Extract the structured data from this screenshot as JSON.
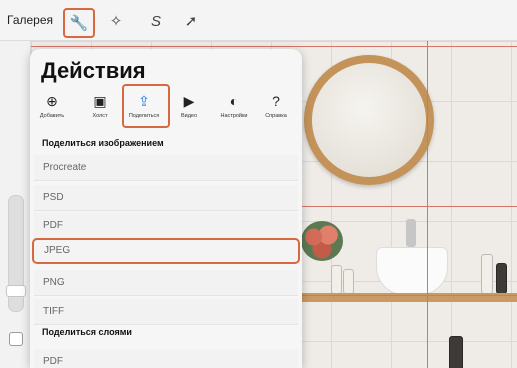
{
  "topbar": {
    "gallery_label": "Галерея",
    "tools": [
      {
        "icon": "wrench-icon",
        "glyph": "🔧"
      },
      {
        "icon": "magic-wand-icon",
        "glyph": "✧"
      },
      {
        "icon": "selection-icon",
        "glyph": "S"
      },
      {
        "icon": "arrow-icon",
        "glyph": "➚"
      }
    ]
  },
  "actions_panel": {
    "title": "Действия",
    "tabs": [
      {
        "label": "Добавить",
        "icon": "add-icon",
        "glyph": "⊕"
      },
      {
        "label": "Холст",
        "icon": "canvas-icon",
        "glyph": "▣"
      },
      {
        "label": "Поделиться",
        "icon": "share-icon",
        "glyph": "⇪"
      },
      {
        "label": "Видео",
        "icon": "play-icon",
        "glyph": "▶"
      },
      {
        "label": "Настройки",
        "icon": "toggle-icon",
        "glyph": "◐"
      },
      {
        "label": "Справка",
        "icon": "help-icon",
        "glyph": "?"
      }
    ],
    "share_image_heading": "Поделиться изображением",
    "image_formats": [
      "Procreate",
      "PSD",
      "PDF",
      "JPEG",
      "PNG",
      "TIFF"
    ],
    "share_layers_heading": "Поделиться слоями",
    "layer_formats": [
      "PDF"
    ]
  },
  "colors": {
    "highlight": "#d8683f",
    "active_tab": "#1677e5",
    "guide": "#d7746a"
  }
}
